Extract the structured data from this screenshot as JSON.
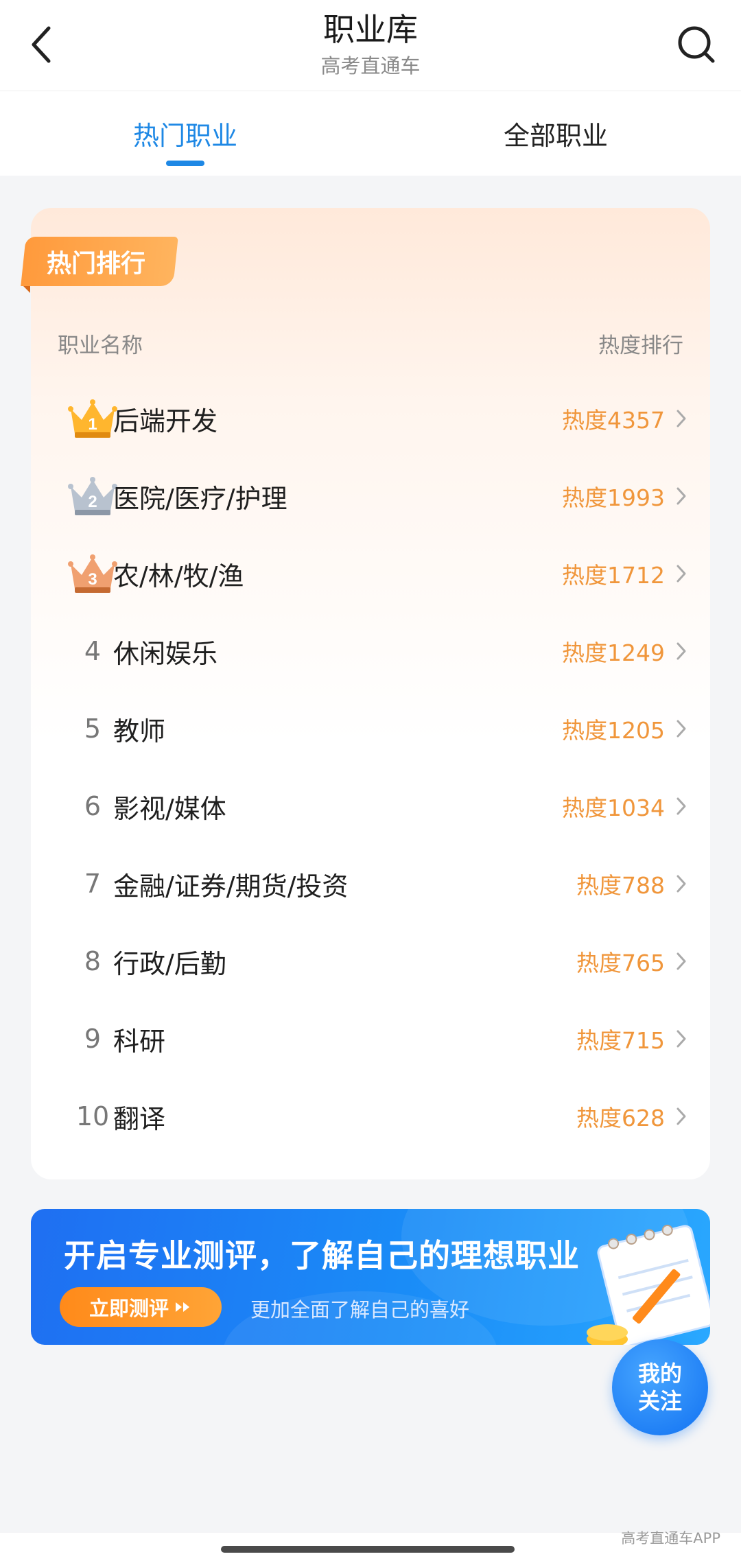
{
  "header": {
    "title": "职业库",
    "subtitle": "高考直通车"
  },
  "tabs": [
    {
      "label": "热门职业",
      "active": true
    },
    {
      "label": "全部职业",
      "active": false
    }
  ],
  "ranking": {
    "badge": "热门排行",
    "col_name": "职业名称",
    "col_heat": "热度排行",
    "items": [
      {
        "rank": "1",
        "name": "后端开发",
        "heat": "热度4357",
        "crown": "gold"
      },
      {
        "rank": "2",
        "name": "医院/医疗/护理",
        "heat": "热度1993",
        "crown": "silver"
      },
      {
        "rank": "3",
        "name": "农/林/牧/渔",
        "heat": "热度1712",
        "crown": "bronze"
      },
      {
        "rank": "4",
        "name": "休闲娱乐",
        "heat": "热度1249"
      },
      {
        "rank": "5",
        "name": "教师",
        "heat": "热度1205"
      },
      {
        "rank": "6",
        "name": "影视/媒体",
        "heat": "热度1034"
      },
      {
        "rank": "7",
        "name": "金融/证券/期货/投资",
        "heat": "热度788"
      },
      {
        "rank": "8",
        "name": "行政/后勤",
        "heat": "热度765"
      },
      {
        "rank": "9",
        "name": "科研",
        "heat": "热度715"
      },
      {
        "rank": "10",
        "name": "翻译",
        "heat": "热度628"
      }
    ]
  },
  "banner": {
    "title": "开启专业测评，了解自己的理想职业",
    "button": "立即测评",
    "subtitle": "更加全面了解自己的喜好"
  },
  "follow": {
    "line1": "我的",
    "line2": "关注"
  },
  "watermark": "高考直通车APP",
  "colors": {
    "accent": "#1e88e5",
    "heat": "#f0963b",
    "badge": "#ff9a3c"
  }
}
